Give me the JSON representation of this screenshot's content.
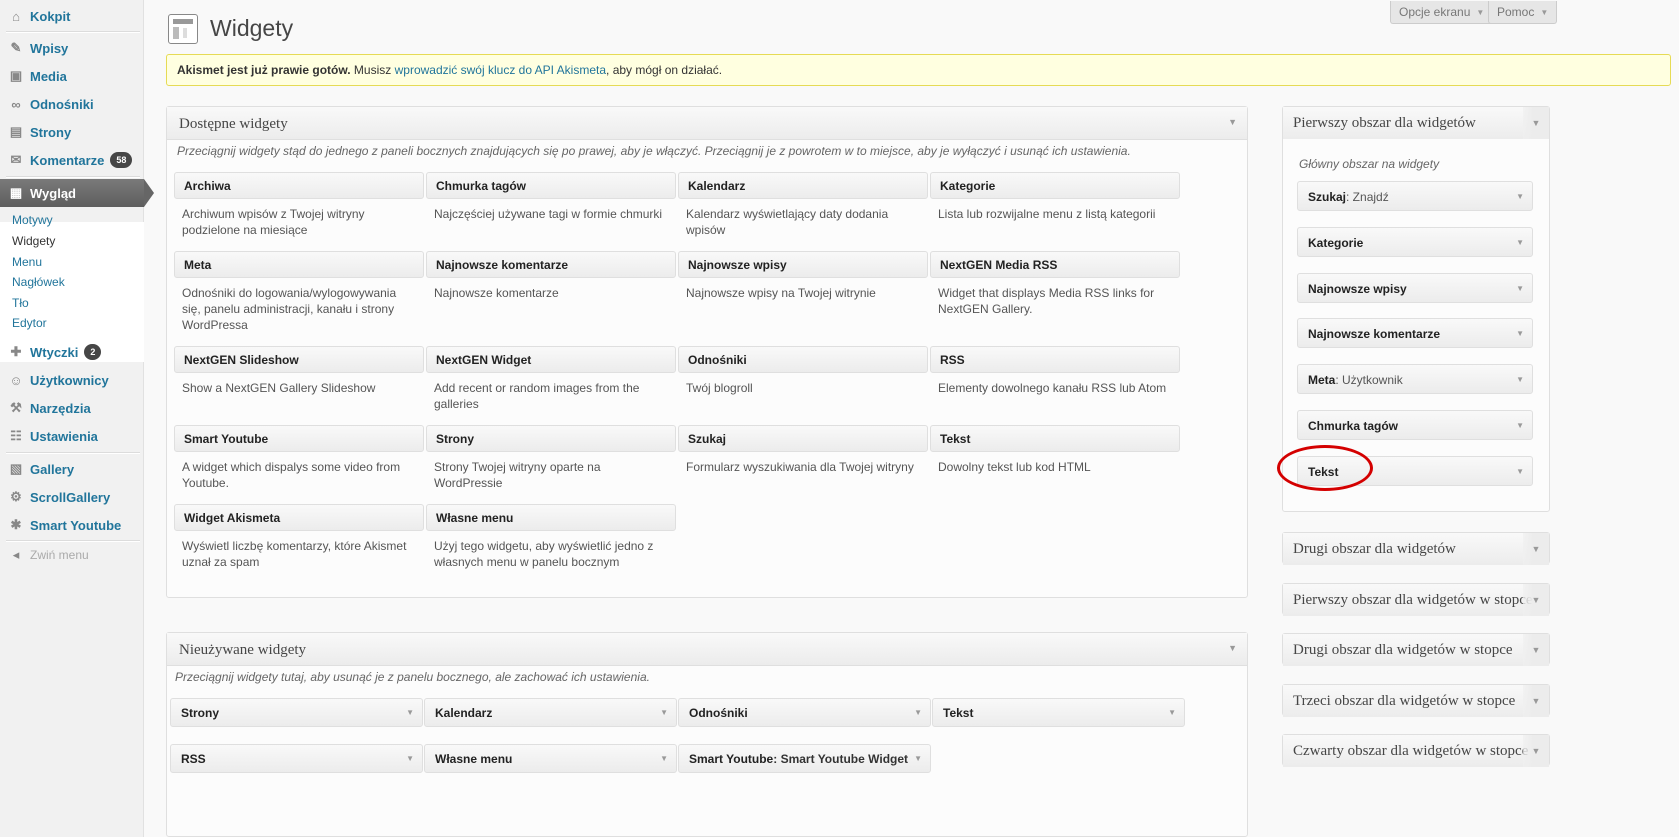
{
  "sidebar": {
    "items": [
      {
        "label": "Kokpit",
        "icon": "home-icon",
        "glyph": "⌂"
      },
      {
        "label": "Wpisy",
        "icon": "pin-icon",
        "glyph": "✎"
      },
      {
        "label": "Media",
        "icon": "media-icon",
        "glyph": "▣"
      },
      {
        "label": "Odnośniki",
        "icon": "link-icon",
        "glyph": "∞"
      },
      {
        "label": "Strony",
        "icon": "page-icon",
        "glyph": "▤"
      },
      {
        "label": "Komentarze",
        "icon": "comment-icon",
        "glyph": "✉",
        "badge": "58"
      },
      {
        "label": "Wygląd",
        "icon": "appearance-icon",
        "glyph": "▦"
      },
      {
        "label": "Wtyczki",
        "icon": "plugin-icon",
        "glyph": "✚",
        "badge": "2"
      },
      {
        "label": "Użytkownicy",
        "icon": "users-icon",
        "glyph": "☺"
      },
      {
        "label": "Narzędzia",
        "icon": "tools-icon",
        "glyph": "⚒"
      },
      {
        "label": "Ustawienia",
        "icon": "settings-icon",
        "glyph": "☷"
      },
      {
        "label": "Gallery",
        "icon": "gallery-icon",
        "glyph": "▧"
      },
      {
        "label": "ScrollGallery",
        "icon": "gear-icon",
        "glyph": "⚙"
      },
      {
        "label": "Smart Youtube",
        "icon": "youtube-icon",
        "glyph": "✱"
      },
      {
        "label": "Zwiń menu",
        "icon": "collapse-icon",
        "glyph": "◂"
      }
    ],
    "submenu": [
      "Motywy",
      "Widgety",
      "Menu",
      "Nagłówek",
      "Tło",
      "Edytor"
    ]
  },
  "header": {
    "title": "Widgety",
    "screen_options": "Opcje ekranu",
    "help": "Pomoc"
  },
  "notice": {
    "bold": "Akismet jest już prawie gotów.",
    "pre": " Musisz ",
    "link": "wprowadzić swój klucz do API Akismeta",
    "post": ", aby mógł on działać."
  },
  "available": {
    "title": "Dostępne widgety",
    "description": "Przeciągnij widgety stąd do jednego z paneli bocznych znajdujących się po prawej, aby je włączyć. Przeciągnij je z powrotem w to miejsce, aby je wyłączyć i usunąć ich ustawienia.",
    "widgets": [
      {
        "name": "Archiwa",
        "desc": "Archiwum wpisów z Twojej witryny podzielone na miesiące"
      },
      {
        "name": "Chmurka tagów",
        "desc": "Najczęściej używane tagi w formie chmurki"
      },
      {
        "name": "Kalendarz",
        "desc": "Kalendarz wyświetlający daty dodania wpisów"
      },
      {
        "name": "Kategorie",
        "desc": "Lista lub rozwijalne menu z listą kategorii"
      },
      {
        "name": "Meta",
        "desc": "Odnośniki do logowania/wylogowywania się, panelu administracji, kanału i strony WordPressa"
      },
      {
        "name": "Najnowsze komentarze",
        "desc": "Najnowsze komentarze"
      },
      {
        "name": "Najnowsze wpisy",
        "desc": "Najnowsze wpisy na Twojej witrynie"
      },
      {
        "name": "NextGEN Media RSS",
        "desc": "Widget that displays Media RSS links for NextGEN Gallery."
      },
      {
        "name": "NextGEN Slideshow",
        "desc": "Show a NextGEN Gallery Slideshow"
      },
      {
        "name": "NextGEN Widget",
        "desc": "Add recent or random images from the galleries"
      },
      {
        "name": "Odnośniki",
        "desc": "Twój blogroll"
      },
      {
        "name": "RSS",
        "desc": "Elementy dowolnego kanału RSS lub Atom"
      },
      {
        "name": "Smart Youtube",
        "desc": "A widget which dispalys some video from Youtube."
      },
      {
        "name": "Strony",
        "desc": "Strony Twojej witryny oparte na WordPressie"
      },
      {
        "name": "Szukaj",
        "desc": "Formularz wyszukiwania dla Twojej witryny"
      },
      {
        "name": "Tekst",
        "desc": "Dowolny tekst lub kod HTML"
      },
      {
        "name": "Widget Akismeta",
        "desc": "Wyświetl liczbę komentarzy, które Akismet uznał za spam"
      },
      {
        "name": "Własne menu",
        "desc": "Użyj tego widgetu, aby wyświetlić jedno z własnych menu w panelu bocznym"
      }
    ]
  },
  "inactive": {
    "title": "Nieużywane widgety",
    "description": "Przeciągnij widgety tutaj, aby usunąć je z panelu bocznego, ale zachować ich ustawienia.",
    "widgets": [
      {
        "name": "Strony",
        "sub": ""
      },
      {
        "name": "Kalendarz",
        "sub": ""
      },
      {
        "name": "Odnośniki",
        "sub": ""
      },
      {
        "name": "Tekst",
        "sub": ""
      },
      {
        "name": "RSS",
        "sub": ""
      },
      {
        "name": "Własne menu",
        "sub": ""
      },
      {
        "name": "Smart Youtube",
        "sub": ": Smart Youtube Widget"
      }
    ]
  },
  "sidebars": {
    "first": {
      "title": "Pierwszy obszar dla widgetów",
      "description": "Główny obszar na widgety",
      "widgets": [
        {
          "name": "Szukaj",
          "sub": ": Znajdź"
        },
        {
          "name": "Kategorie",
          "sub": ""
        },
        {
          "name": "Najnowsze wpisy",
          "sub": ""
        },
        {
          "name": "Najnowsze komentarze",
          "sub": ""
        },
        {
          "name": "Meta",
          "sub": ": Użytkownik"
        },
        {
          "name": "Chmurka tagów",
          "sub": ""
        },
        {
          "name": "Tekst",
          "sub": ""
        }
      ]
    },
    "collapsed": [
      "Drugi obszar dla widgetów",
      "Pierwszy obszar dla widgetów w stopce",
      "Drugi obszar dla widgetów w stopce",
      "Trzeci obszar dla widgetów w stopce",
      "Czwarty obszar dla widgetów w stopce"
    ]
  },
  "colors": {
    "link": "#21759b",
    "highlight": "#d40000",
    "active_menu": "#666666"
  }
}
